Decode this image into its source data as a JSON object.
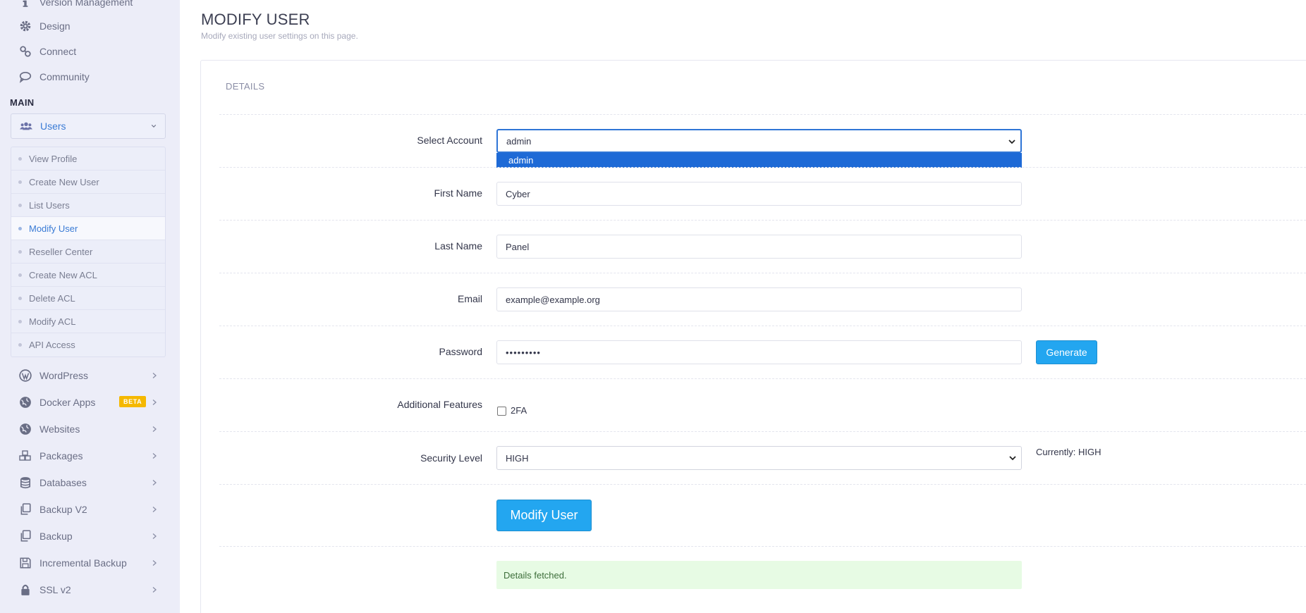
{
  "sidebar": {
    "top_items": [
      {
        "label": "Version Management",
        "icon": "info-icon"
      },
      {
        "label": "Design",
        "icon": "gear-icon"
      },
      {
        "label": "Connect",
        "icon": "link-icon"
      },
      {
        "label": "Community",
        "icon": "chat-icon"
      }
    ],
    "section_label": "MAIN",
    "active_group": {
      "label": "Users",
      "icon": "users-icon"
    },
    "submenu": [
      {
        "label": "View Profile"
      },
      {
        "label": "Create New User"
      },
      {
        "label": "List Users"
      },
      {
        "label": "Modify User",
        "active": true
      },
      {
        "label": "Reseller Center"
      },
      {
        "label": "Create New ACL"
      },
      {
        "label": "Delete ACL"
      },
      {
        "label": "Modify ACL"
      },
      {
        "label": "API Access"
      }
    ],
    "bottom_items": [
      {
        "label": "WordPress",
        "icon": "wordpress-icon"
      },
      {
        "label": "Docker Apps",
        "icon": "globe-icon",
        "badge": "BETA"
      },
      {
        "label": "Websites",
        "icon": "globe-icon"
      },
      {
        "label": "Packages",
        "icon": "cubes-icon"
      },
      {
        "label": "Databases",
        "icon": "database-icon"
      },
      {
        "label": "Backup V2",
        "icon": "copy-icon"
      },
      {
        "label": "Backup",
        "icon": "copy-icon"
      },
      {
        "label": "Incremental Backup",
        "icon": "save-icon"
      },
      {
        "label": "SSL v2",
        "icon": "lock-icon"
      }
    ]
  },
  "page": {
    "title": "MODIFY USER",
    "subtitle": "Modify existing user settings on this page."
  },
  "form": {
    "section_title": "DETAILS",
    "select_account": {
      "label": "Select Account",
      "value": "admin",
      "options": [
        "admin"
      ]
    },
    "first_name": {
      "label": "First Name",
      "value": "Cyber"
    },
    "last_name": {
      "label": "Last Name",
      "value": "Panel"
    },
    "email": {
      "label": "Email",
      "value": "example@example.org"
    },
    "password": {
      "label": "Password",
      "value": "•••••••••"
    },
    "generate_label": "Generate",
    "additional_features": {
      "label": "Additional Features",
      "option": "2FA",
      "checked": false
    },
    "security_level": {
      "label": "Security Level",
      "value": "HIGH",
      "current_text": "Currently: HIGH"
    },
    "submit_label": "Modify User",
    "status_message": "Details fetched."
  },
  "colors": {
    "accent": "#23a6f0",
    "link_active": "#3a7bd5",
    "sidebar_bg": "#ecedf8",
    "success_bg": "#e7fbe4",
    "beta_badge": "#f5b800"
  }
}
